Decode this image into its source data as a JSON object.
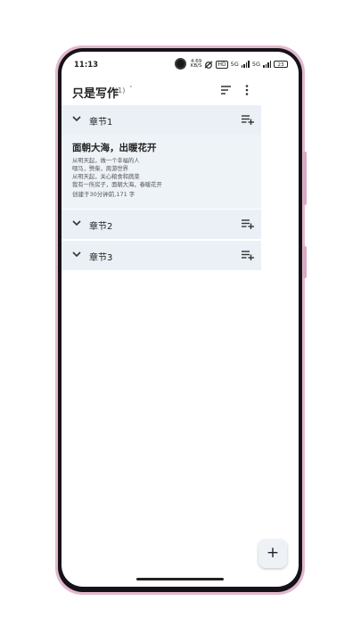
{
  "status_bar": {
    "time": "11:13",
    "speed_value": "4.69",
    "speed_unit": "KB/S",
    "hd_label": "HD",
    "network_label_1": "5G",
    "network_label_2": "5G",
    "battery": "23"
  },
  "app_bar": {
    "title": "只是写作",
    "count": "(1)",
    "caret": "˅"
  },
  "chapters": [
    {
      "label": "章节1"
    },
    {
      "label": "章节2"
    },
    {
      "label": "章节3"
    }
  ],
  "document": {
    "title": "面朝大海，出暖花开",
    "lines": [
      "从明天起，做一个幸福的人",
      "喂马，劈柴，周游世界",
      "从明天起，关心粮食和蔬菜",
      "我有一所房子，面朝大海，春暖花开"
    ],
    "meta": "创建于30分钟前,171 字"
  },
  "fab": {
    "label": "+"
  },
  "colors": {
    "frame": "#e2b9ce",
    "chapter_bg": "#eaf0f6",
    "card_bg": "#eef3f8"
  }
}
